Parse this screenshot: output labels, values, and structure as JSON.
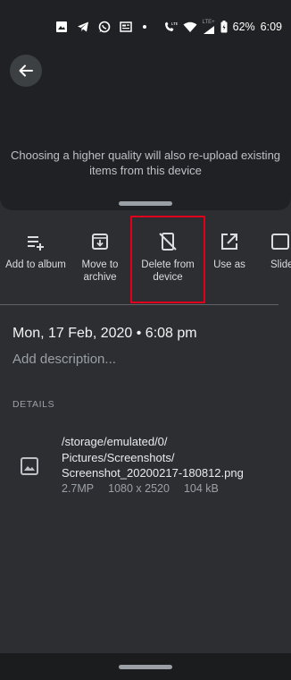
{
  "status_bar": {
    "icons_left": [
      "image-icon",
      "telegram-icon",
      "whatsapp-icon",
      "news-icon",
      "dot-icon"
    ],
    "icons_right": [
      "call-lte-icon",
      "wifi-icon",
      "signal-lte-icon",
      "battery-icon"
    ],
    "lte_label": "LTE",
    "lte2_label": "LTE+",
    "battery": "62%",
    "time": "6:09"
  },
  "top": {
    "info_text": "Choosing a higher quality will also re-upload existing items from this device"
  },
  "actions": [
    {
      "label": "Add to album",
      "icon": "add-to-album-icon"
    },
    {
      "label": "Move to\narchive",
      "icon": "archive-icon"
    },
    {
      "label": "Delete from\ndevice",
      "icon": "delete-from-device-icon"
    },
    {
      "label": "Use as",
      "icon": "open-external-icon"
    },
    {
      "label": "Slide",
      "icon": "slideshow-icon"
    }
  ],
  "info": {
    "date": "Mon, 17 Feb, 2020  •  6:08 pm",
    "add_description": "Add description...",
    "details_header": "DETAILS"
  },
  "file": {
    "path": "/storage/emulated/0/\nPictures/Screenshots/\nScreenshot_20200217-180812.png",
    "megapixels": "2.7MP",
    "resolution": "1080 x 2520",
    "size": "104 kB"
  },
  "colors": {
    "background": "#202124",
    "sheet": "#2d2e31",
    "highlight": "#e0001b"
  }
}
